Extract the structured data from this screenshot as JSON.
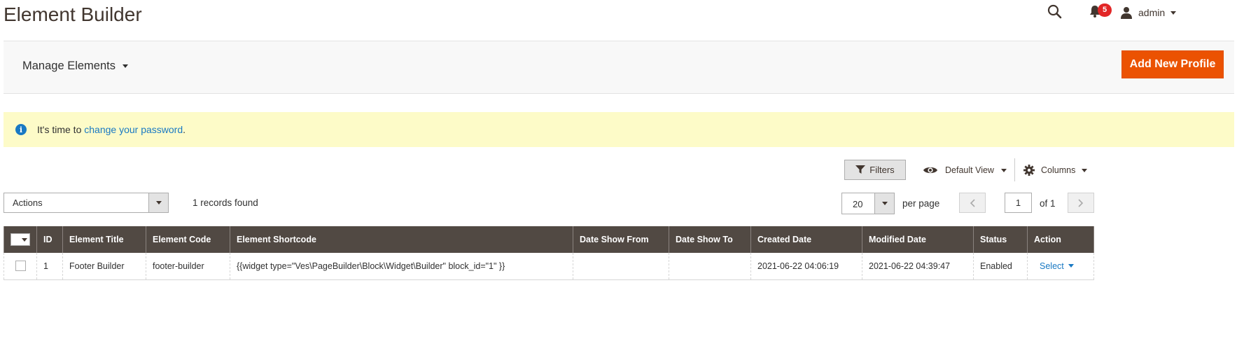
{
  "header": {
    "title": "Element Builder",
    "notifications_count": "5",
    "user_name": "admin"
  },
  "actions_bar": {
    "switcher_label": "Manage Elements",
    "add_button_label": "Add New Profile"
  },
  "message": {
    "prefix": "It's time to ",
    "link_text": "change your password",
    "suffix": "."
  },
  "toolbar": {
    "filters_label": "Filters",
    "view_label": "Default View",
    "columns_label": "Columns",
    "actions_label": "Actions",
    "records_found": "1 records found",
    "per_page_value": "20",
    "per_page_label": "per page",
    "current_page": "1",
    "of_pages": "of 1"
  },
  "table": {
    "columns": [
      "ID",
      "Element Title",
      "Element Code",
      "Element Shortcode",
      "Date Show From",
      "Date Show To",
      "Created Date",
      "Modified Date",
      "Status",
      "Action"
    ],
    "rows": [
      {
        "id": "1",
        "title": "Footer Builder",
        "code": "footer-builder",
        "shortcode": "{{widget type=\"Ves\\PageBuilder\\Block\\Widget\\Builder\" block_id=\"1\" }}",
        "date_from": "",
        "date_to": "",
        "created": "2021-06-22 04:06:19",
        "modified": "2021-06-22 04:39:47",
        "status": "Enabled",
        "action": "Select"
      }
    ]
  },
  "colors": {
    "accent": "#eb5202",
    "header_bg": "#514943",
    "link": "#1979c3",
    "message_bg": "#fdfbc8",
    "badge": "#e22626"
  }
}
